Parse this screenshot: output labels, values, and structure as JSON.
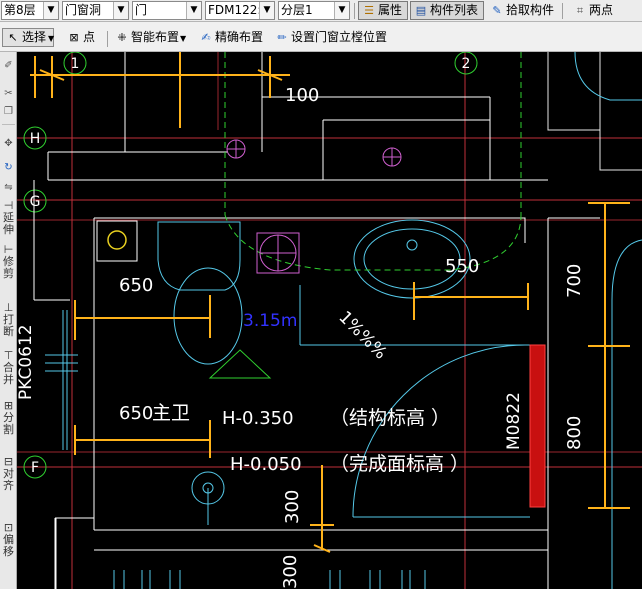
{
  "toolbar1": {
    "floor_select": "第8层",
    "type_select": "门窗洞",
    "subtype_select": "门",
    "component_select": "FDM122:",
    "layer_select": "分层1",
    "properties_label": "属性",
    "component_list_label": "构件列表",
    "pick_component_label": "拾取构件",
    "two_points_label": "两点"
  },
  "toolbar2": {
    "select_label": "选择",
    "point_label": "点",
    "smart_layout_label": "智能布置",
    "precise_layout_label": "精确布置",
    "set_door_window_label": "设置门窗立樘位置"
  },
  "sidebar": {
    "labels": [
      "延伸",
      "修剪",
      "打断",
      "合并",
      "分割",
      "对齐",
      "偏移"
    ]
  },
  "canvas": {
    "axis_labels": {
      "axis_1": "1",
      "axis_2": "2",
      "axis_h": "H",
      "axis_g": "G",
      "axis_f": "F"
    },
    "dimensions": {
      "dim_100": "100",
      "dim_650_a": "650",
      "dim_650_b": "650",
      "dim_550": "550",
      "dim_700": "700",
      "dim_800": "800",
      "dim_300": "300",
      "dim_300_b": "300"
    },
    "annotations": {
      "height_label": "3.15m",
      "slope_label": "1%%%",
      "room_name": "主卫",
      "structural_elev": "H-0.350",
      "structural_note": "（结构标高  ）",
      "finish_elev": "H-0.050",
      "finish_note": "（完成面标高  ）",
      "door_code": "M0822",
      "window_code": "PKC0612"
    },
    "colors": {
      "background": "#000000",
      "wall": "#ffffff",
      "dimension": "#ffb31a",
      "axis": "#c0303a",
      "cyan": "#55c8e8",
      "green": "#30d030",
      "door": "#d01010",
      "blue_text": "#3232ff"
    }
  }
}
